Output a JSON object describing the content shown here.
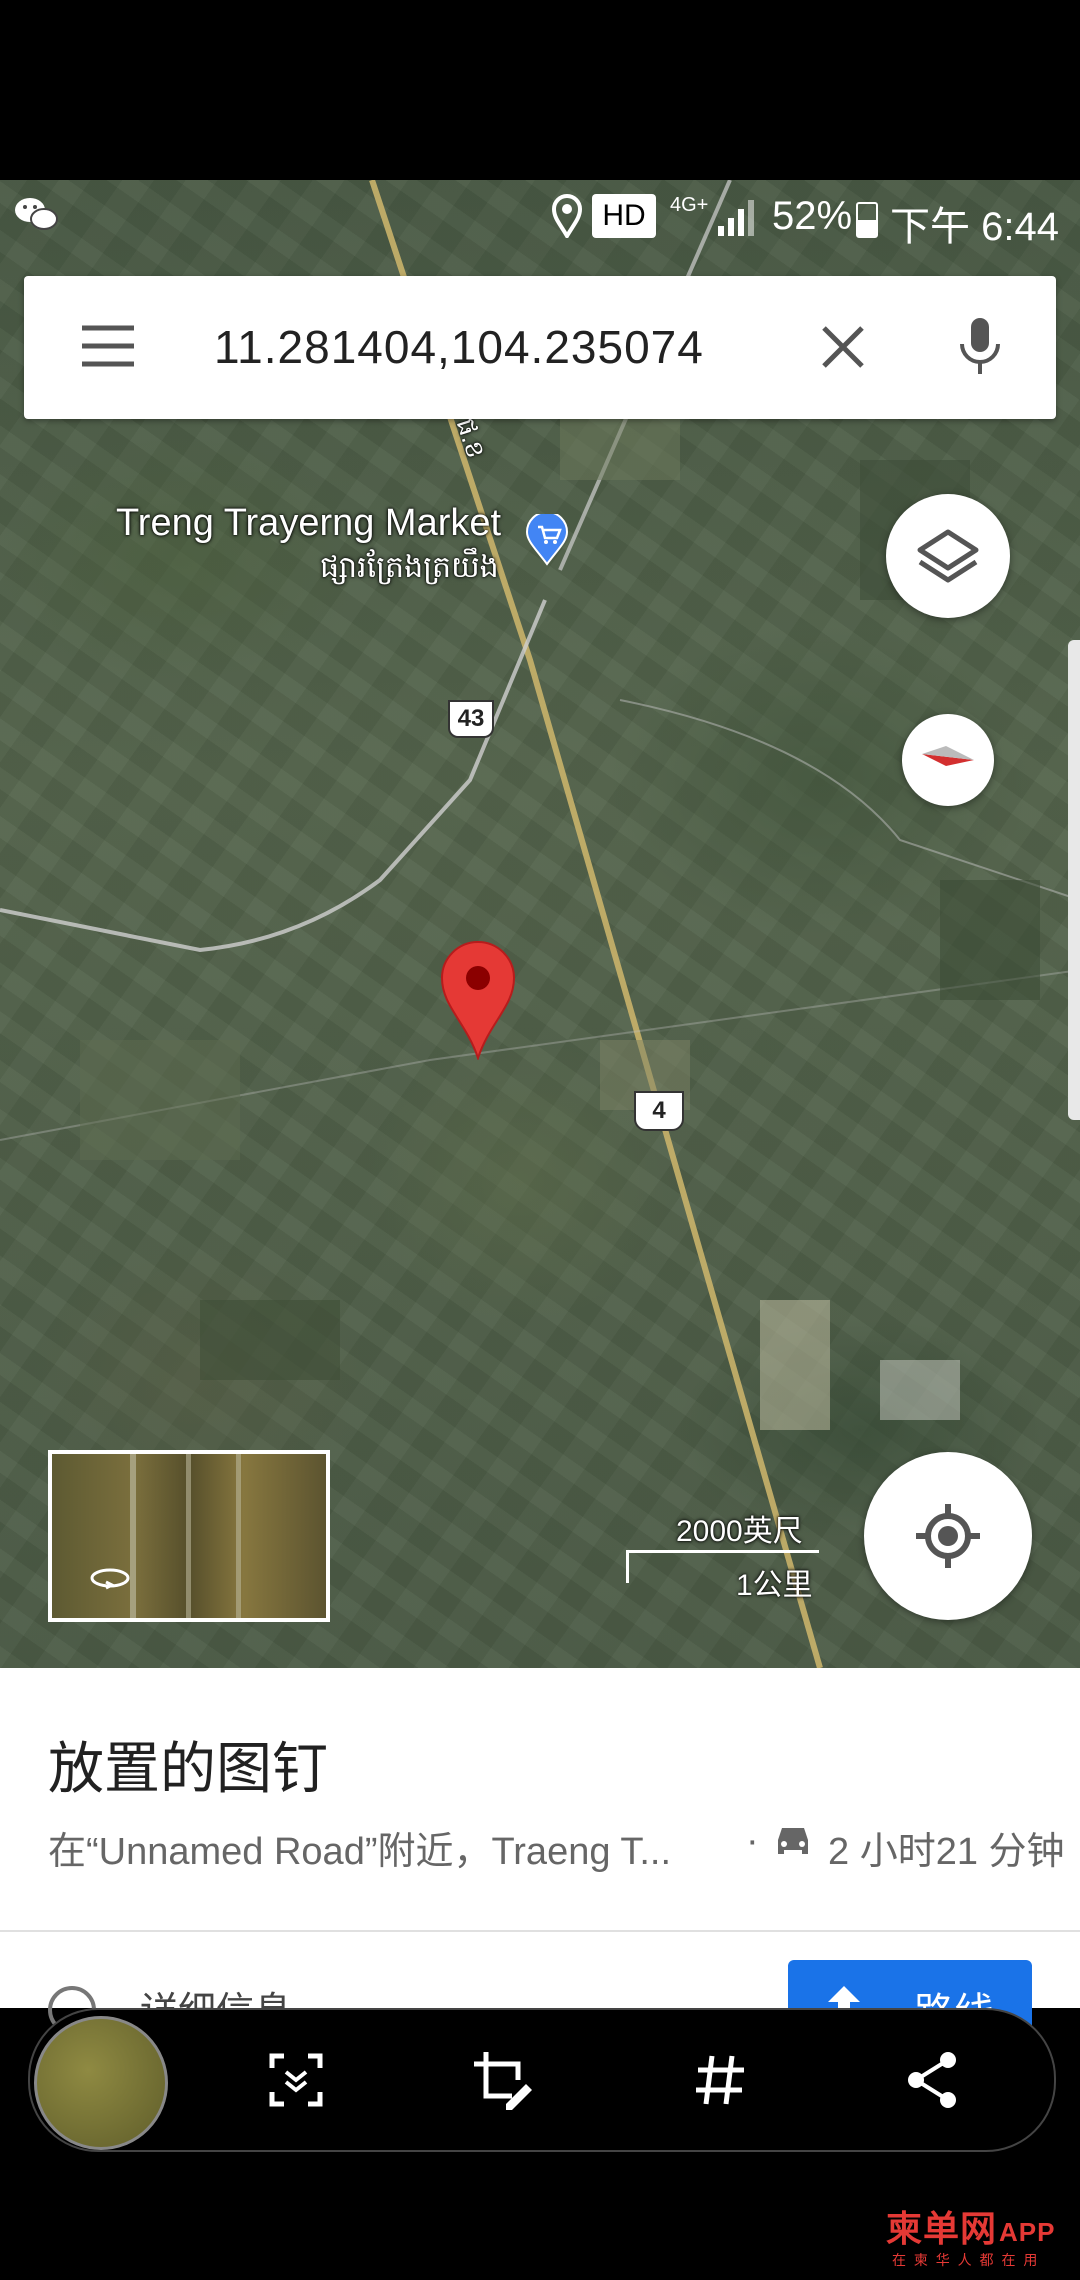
{
  "status_bar": {
    "hd": "HD",
    "network": "4G+",
    "battery": "52%",
    "time": "下午 6:44"
  },
  "search": {
    "query": "11.281404,104.235074"
  },
  "map": {
    "market_name_en": "Treng Trayerng Market",
    "market_name_km": "ផ្សារត្រែងត្រយឹង",
    "road_label_top": "ផ.ខ",
    "route_43": "43",
    "route_4": "4",
    "scale_ft": "2000英尺",
    "scale_km": "1公里"
  },
  "place": {
    "title": "放置的图钉",
    "address": "在“Unnamed Road”附近，Traeng T...",
    "separator": "·",
    "drive_time": "2 小时21 分钟",
    "detail_label": "详细信息",
    "route_label": "路线"
  },
  "watermark": {
    "brand": "柬单网",
    "app": "APP",
    "tagline": "在 柬 华 人 都 在 用"
  },
  "colors": {
    "pin": "#e53935",
    "store_icon": "#4285f4",
    "route_button": "#1a73e8",
    "watermark": "#e53935"
  }
}
